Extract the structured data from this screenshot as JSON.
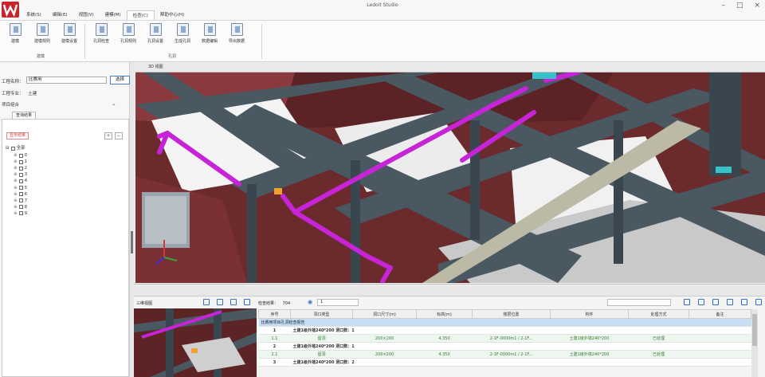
{
  "app": {
    "title": "Ledoit Studio",
    "logo": "W",
    "brand_color": "#c8252c",
    "window_controls": [
      "–",
      "□",
      "×"
    ]
  },
  "menu": [
    "系统(S)",
    "编辑(E)",
    "视图(V)",
    "建模(M)",
    "检查(C)",
    "帮助中心(H)"
  ],
  "menu_active_index": 4,
  "ribbon": {
    "groups": [
      {
        "label": "建模",
        "buttons": [
          "建模",
          "建模规则",
          "建模设置"
        ]
      },
      {
        "label": "孔洞",
        "buttons": [
          "孔洞检查",
          "孔洞规则",
          "孔洞设置",
          "生成孔洞",
          "数据编辑",
          "导出数据"
        ]
      }
    ]
  },
  "left_panel": {
    "project_label": "工程名称：",
    "project_value": "比赛用",
    "select_button": "选择",
    "professional_label": "工程专业：",
    "professional_value": "土建",
    "category_label": "项目组合",
    "pane_tab": "查询结果",
    "show_results": "显示结果",
    "plus_button": "+",
    "minus_button": "−",
    "tree_root": "全部",
    "tree_items": [
      "0",
      "1",
      "2",
      "3",
      "4",
      "5",
      "6",
      "7",
      "8",
      "9"
    ]
  },
  "view_tab": "3D 视图",
  "bottom": {
    "mini_label": "三维视图",
    "check_result_label": "检查结果：",
    "check_result_count": "704",
    "page_value": "1",
    "columns": [
      "序号",
      "洞口类型",
      "洞口尺寸(m)",
      "标高(m)",
      "楼层位置",
      "构件",
      "处理方式",
      "备注"
    ],
    "rows": [
      {
        "kind": "grp",
        "cells": [
          "比赛用项目孔洞检查报告"
        ]
      },
      {
        "kind": "sub",
        "cells": [
          "1",
          "土建1级外墙240*200 洞口数：1"
        ]
      },
      {
        "kind": "det",
        "cells": [
          "1.1",
          "留洞",
          "200×200",
          "4.350",
          "2-1F-0000m1 / 2-1F...",
          "土建1级外墙240*200",
          "已处理",
          ""
        ]
      },
      {
        "kind": "sub",
        "cells": [
          "2",
          "土建1级外墙240*200 洞口数：1"
        ]
      },
      {
        "kind": "det",
        "cells": [
          "2.1",
          "留洞",
          "200×200",
          "4.350",
          "2-1F-0000m1 / 2-1F...",
          "土建1级外墙240*200",
          "已处理",
          ""
        ]
      },
      {
        "kind": "sub",
        "cells": [
          "3",
          "土建1级外墙240*200 洞口数：2"
        ]
      }
    ]
  }
}
